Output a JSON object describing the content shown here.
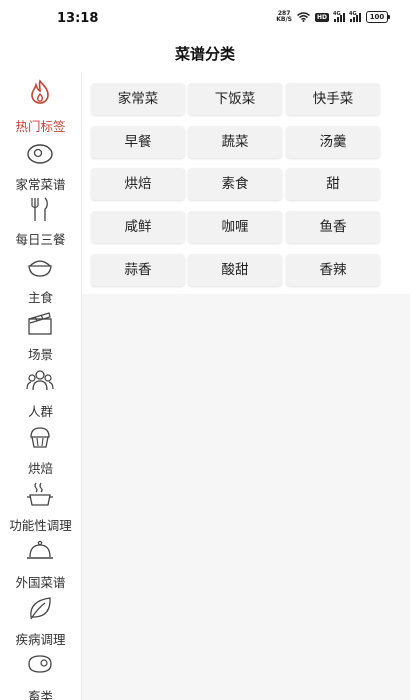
{
  "status_bar": {
    "time": "13:18",
    "net_speed_value": "287",
    "net_speed_unit": "KB/S",
    "hd_label": "HD",
    "sig1_label": "4G",
    "sig2_label": "4G",
    "battery": "100",
    "icons": [
      "wifi-icon",
      "signal-icon",
      "battery-icon"
    ]
  },
  "header": {
    "title": "菜谱分类"
  },
  "sidebar": {
    "active_color": "#c14436",
    "items": [
      {
        "label": "热门标签",
        "icon": "flame-icon",
        "active": true
      },
      {
        "label": "家常菜谱",
        "icon": "egg-plate-icon",
        "active": false
      },
      {
        "label": "每日三餐",
        "icon": "cutlery-icon",
        "active": false
      },
      {
        "label": "主食",
        "icon": "rice-bowl-icon",
        "active": false
      },
      {
        "label": "场景",
        "icon": "clapperboard-icon",
        "active": false
      },
      {
        "label": "人群",
        "icon": "people-icon",
        "active": false
      },
      {
        "label": "烘焙",
        "icon": "muffin-icon",
        "active": false
      },
      {
        "label": "功能性调理",
        "icon": "steaming-pot-icon",
        "active": false
      },
      {
        "label": "外国菜谱",
        "icon": "cloche-icon",
        "active": false
      },
      {
        "label": "疾病调理",
        "icon": "leaf-icon",
        "active": false
      },
      {
        "label": "畜类",
        "icon": "steak-icon",
        "active": false
      }
    ]
  },
  "tags": [
    [
      "家常菜",
      "下饭菜",
      "快手菜"
    ],
    [
      "早餐",
      "蔬菜",
      "汤羹"
    ],
    [
      "烘焙",
      "素食",
      "甜"
    ],
    [
      "咸鲜",
      "咖喱",
      "鱼香"
    ],
    [
      "蒜香",
      "酸甜",
      "香辣"
    ]
  ]
}
